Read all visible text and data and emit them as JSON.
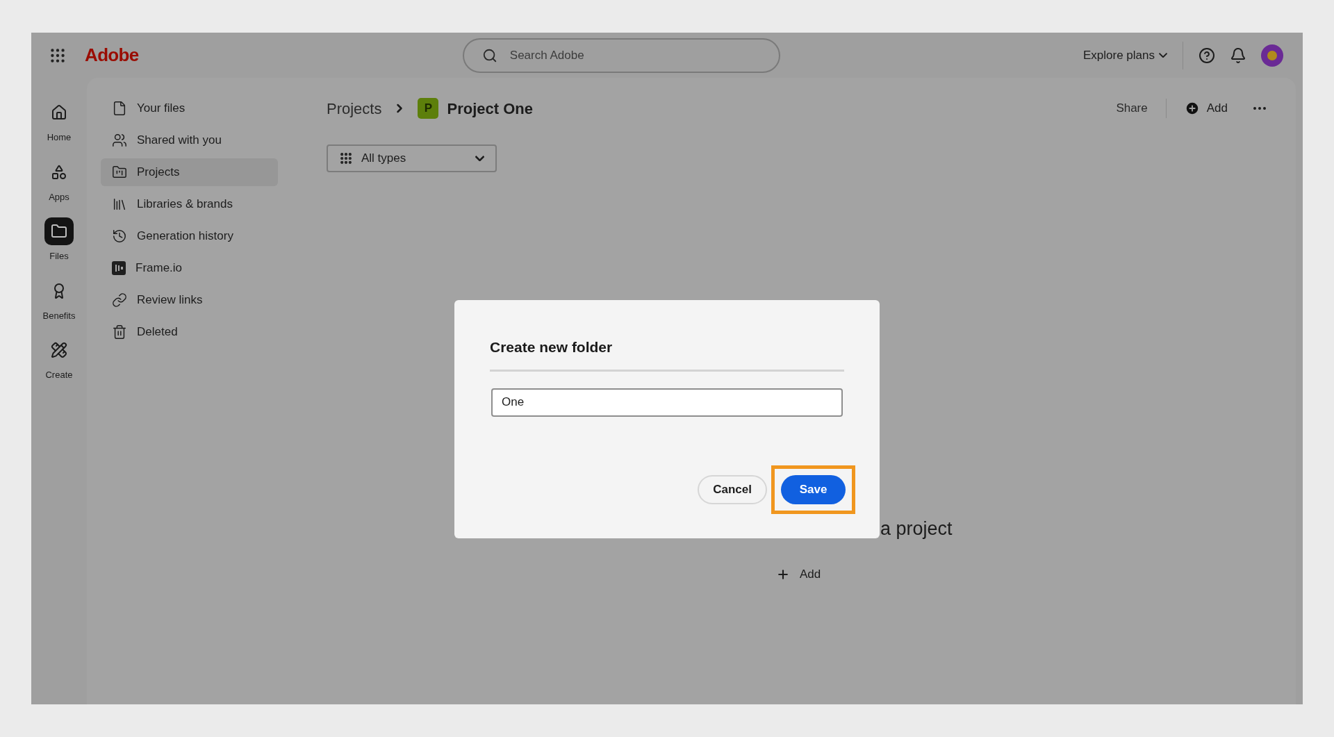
{
  "top_bar": {
    "logo": "Adobe",
    "search": {
      "placeholder": "Search Adobe"
    },
    "explore_plans": "Explore plans"
  },
  "rail": [
    {
      "label": "Home",
      "selected": false
    },
    {
      "label": "Apps",
      "selected": false
    },
    {
      "label": "Files",
      "selected": true
    },
    {
      "label": "Benefits",
      "selected": false
    },
    {
      "label": "Create",
      "selected": false
    }
  ],
  "nav": [
    {
      "label": "Your files",
      "selected": false
    },
    {
      "label": "Shared with you",
      "selected": false
    },
    {
      "label": "Projects",
      "selected": true
    },
    {
      "label": "Libraries & brands",
      "selected": false
    },
    {
      "label": "Generation history",
      "selected": false
    },
    {
      "label": "Frame.io",
      "selected": false
    },
    {
      "label": "Review links",
      "selected": false
    },
    {
      "label": "Deleted",
      "selected": false
    }
  ],
  "breadcrumb": {
    "parent": "Projects",
    "badge": "P",
    "current": "Project One"
  },
  "actions": {
    "share": "Share",
    "add": "Add"
  },
  "filter": "All types",
  "empty_state": {
    "title": "a project",
    "add": "Add"
  },
  "dialog": {
    "title": "Create new folder",
    "input_value": "One",
    "cancel": "Cancel",
    "save": "Save",
    "save_highlighted": true
  }
}
